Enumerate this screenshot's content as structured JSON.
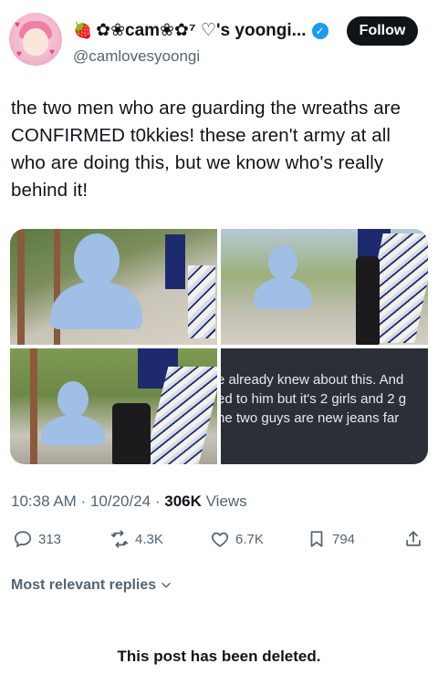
{
  "header": {
    "display_name": "✿❀cam❀✿⁷ ♡'s yoongi...",
    "handle": "@camlovesyoongi",
    "follow_label": "Follow"
  },
  "tweet": {
    "text": "the two men who are guarding the wreaths are CONFIRMED t0kkies! these aren't army at all who are doing this, but we know who's really behind it!",
    "media": [
      {
        "type": "photo"
      },
      {
        "type": "photo"
      },
      {
        "type": "photo"
      },
      {
        "type": "screenshot",
        "lines": [
          "e already knew about this. And",
          "ed to him but it's 2 girls and 2 g",
          "he two guys are new jeans far"
        ]
      }
    ],
    "time": "10:38 AM",
    "date": "10/20/24",
    "views_count": "306K",
    "views_label": "Views"
  },
  "actions": {
    "replies": "313",
    "reposts": "4.3K",
    "likes": "6.7K",
    "bookmarks": "794"
  },
  "replies_sort_label": "Most relevant replies",
  "deleted_notice": "This post has been deleted."
}
